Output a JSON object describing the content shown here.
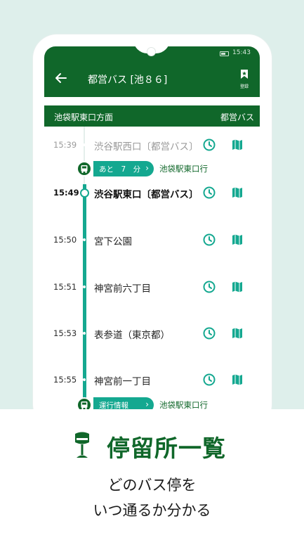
{
  "colors": {
    "primary": "#10672a",
    "accent": "#14a890",
    "background": "#deefeb"
  },
  "status_bar": {
    "time": "15:43",
    "icons": [
      "battery-icon"
    ]
  },
  "app_bar": {
    "back_icon": "arrow-left-icon",
    "title": "都営バス [池８６]",
    "register_icon": "bookmark-icon",
    "register_label": "登録"
  },
  "sub_header": {
    "direction": "池袋駅東口方面",
    "operator": "都営バス"
  },
  "stops": [
    {
      "time": "15:39",
      "name": "渋谷駅西口〔都営バス〕",
      "state": "past"
    },
    {
      "time": "15:49",
      "name": "渋谷駅東口〔都営バス〕",
      "state": "current"
    },
    {
      "time": "15:50",
      "name": "宮下公園",
      "state": "upcoming"
    },
    {
      "time": "15:51",
      "name": "神宮前六丁目",
      "state": "upcoming"
    },
    {
      "time": "15:53",
      "name": "表参道（東京都）",
      "state": "upcoming"
    },
    {
      "time": "15:55",
      "name": "神宮前一丁目",
      "state": "upcoming"
    }
  ],
  "bus_markers": [
    {
      "label": "あと　7　分",
      "destination": "池袋駅東口行"
    },
    {
      "label": "運行情報",
      "destination": "池袋駅東口行"
    }
  ],
  "promo": {
    "headline_icon": "bus-stop-icon",
    "headline": "停留所一覧",
    "line1": "どのバス停を",
    "line2": "いつ通るか分かる"
  }
}
